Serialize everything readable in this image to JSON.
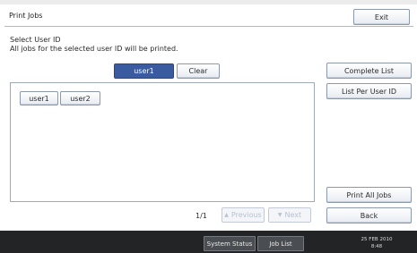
{
  "header": {
    "title": "Print Jobs",
    "exit_label": "Exit"
  },
  "instructions": {
    "line1": "Select User ID",
    "line2": "All jobs for the selected user ID will be printed."
  },
  "selection": {
    "selected_user": "user1",
    "clear_label": "Clear"
  },
  "user_list": [
    "user1",
    "user2"
  ],
  "side_buttons": {
    "complete_list": "Complete List",
    "list_per_user": "List Per User ID",
    "print_all": "Print All Jobs",
    "back": "Back"
  },
  "pagination": {
    "page": "1/1",
    "previous_label": "Previous",
    "next_label": "Next"
  },
  "status_bar": {
    "system_status": "System Status",
    "job_list": "Job List",
    "date": "25 FEB  2010",
    "time": "8:48"
  },
  "colors": {
    "selected_accent": "#3a5ba0",
    "status_bar_bg": "#222426"
  }
}
